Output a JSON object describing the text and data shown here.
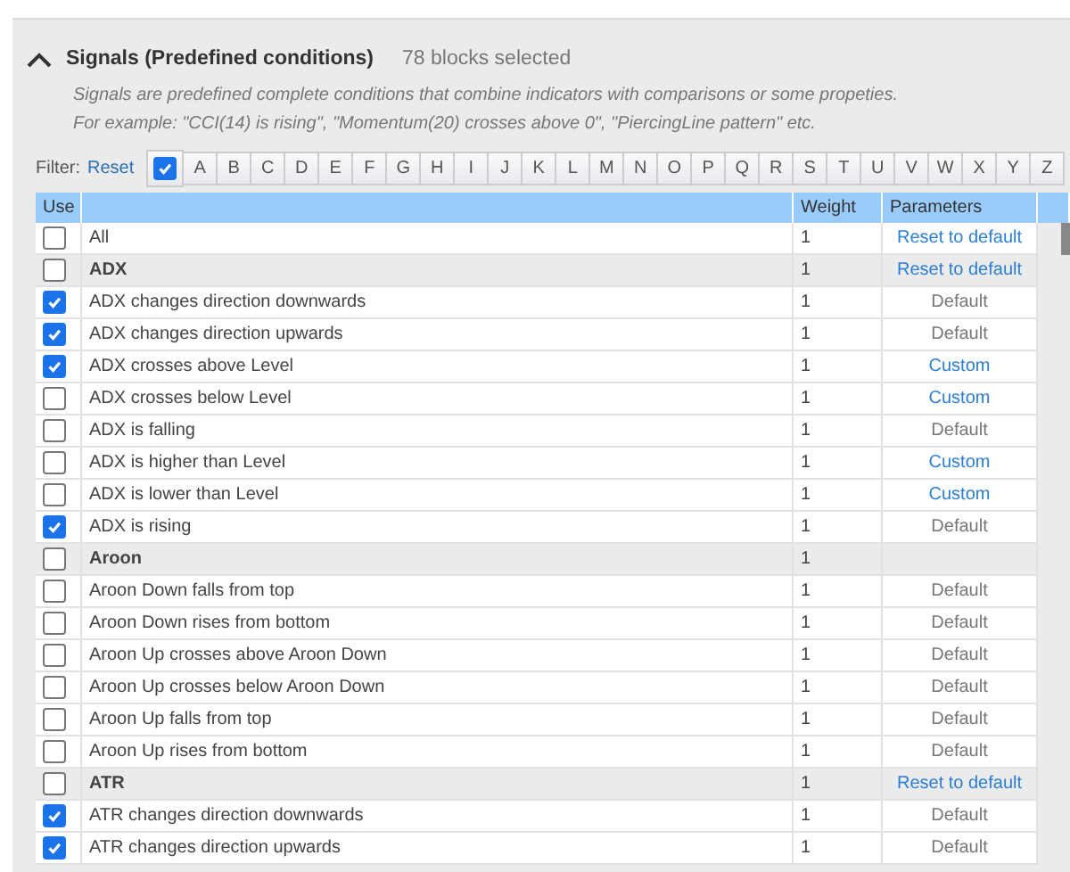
{
  "section": {
    "expanded": true,
    "title": "Signals (Predefined conditions)",
    "count": "78 blocks selected",
    "description": [
      "Signals are predefined complete conditions that combine indicators with comparisons or some propeties.",
      "For example: \"CCI(14) is rising\", \"Momentum(20) crosses above 0\", \"PiercingLine pattern\" etc."
    ]
  },
  "filter": {
    "label": "Filter:",
    "reset": "Reset",
    "all_checked": true,
    "letters": [
      {
        "label": "A",
        "selected": false
      },
      {
        "label": "B",
        "selected": false
      },
      {
        "label": "C",
        "selected": false
      },
      {
        "label": "D",
        "selected": false
      },
      {
        "label": "E",
        "selected": false
      },
      {
        "label": "F",
        "selected": false
      },
      {
        "label": "G",
        "selected": false
      },
      {
        "label": "H",
        "selected": false
      },
      {
        "label": "I",
        "selected": false
      },
      {
        "label": "J",
        "selected": false
      },
      {
        "label": "K",
        "selected": false
      },
      {
        "label": "L",
        "selected": false
      },
      {
        "label": "M",
        "selected": false
      },
      {
        "label": "N",
        "selected": false
      },
      {
        "label": "O",
        "selected": false
      },
      {
        "label": "P",
        "selected": false
      },
      {
        "label": "Q",
        "selected": false
      },
      {
        "label": "R",
        "selected": false
      },
      {
        "label": "S",
        "selected": false
      },
      {
        "label": "T",
        "selected": false
      },
      {
        "label": "U",
        "selected": false
      },
      {
        "label": "V",
        "selected": false
      },
      {
        "label": "W",
        "selected": false
      },
      {
        "label": "X",
        "selected": false
      },
      {
        "label": "Y",
        "selected": false
      },
      {
        "label": "Z",
        "selected": false
      }
    ]
  },
  "table": {
    "columns": [
      "Use",
      "",
      "Weight",
      "Parameters"
    ],
    "rows": [
      {
        "kind": "all",
        "checked": false,
        "name": "All",
        "weight": "1",
        "parameters": {
          "text": "Reset to default",
          "link": true
        }
      },
      {
        "kind": "group",
        "checked": false,
        "name": "ADX",
        "weight": "1",
        "parameters": {
          "text": "Reset to default",
          "link": true
        }
      },
      {
        "kind": "item",
        "checked": true,
        "name": "ADX changes direction downwards",
        "weight": "1",
        "parameters": {
          "text": "Default",
          "link": false
        }
      },
      {
        "kind": "item",
        "checked": true,
        "name": "ADX changes direction upwards",
        "weight": "1",
        "parameters": {
          "text": "Default",
          "link": false
        }
      },
      {
        "kind": "item",
        "checked": true,
        "name": "ADX crosses above Level",
        "weight": "1",
        "parameters": {
          "text": "Custom",
          "link": true
        }
      },
      {
        "kind": "item",
        "checked": false,
        "name": "ADX crosses below Level",
        "weight": "1",
        "parameters": {
          "text": "Custom",
          "link": true
        }
      },
      {
        "kind": "item",
        "checked": false,
        "name": "ADX is falling",
        "weight": "1",
        "parameters": {
          "text": "Default",
          "link": false
        }
      },
      {
        "kind": "item",
        "checked": false,
        "name": "ADX is higher than Level",
        "weight": "1",
        "parameters": {
          "text": "Custom",
          "link": true
        }
      },
      {
        "kind": "item",
        "checked": false,
        "name": "ADX is lower than Level",
        "weight": "1",
        "parameters": {
          "text": "Custom",
          "link": true
        }
      },
      {
        "kind": "item",
        "checked": true,
        "name": "ADX is rising",
        "weight": "1",
        "parameters": {
          "text": "Default",
          "link": false
        }
      },
      {
        "kind": "group",
        "checked": false,
        "name": "Aroon",
        "weight": "1"
      },
      {
        "kind": "item",
        "checked": false,
        "name": "Aroon Down falls from top",
        "weight": "1",
        "parameters": {
          "text": "Default",
          "link": false
        }
      },
      {
        "kind": "item",
        "checked": false,
        "name": "Aroon Down rises from bottom",
        "weight": "1",
        "parameters": {
          "text": "Default",
          "link": false
        }
      },
      {
        "kind": "item",
        "checked": false,
        "name": "Aroon Up crosses above Aroon Down",
        "weight": "1",
        "parameters": {
          "text": "Default",
          "link": false
        }
      },
      {
        "kind": "item",
        "checked": false,
        "name": "Aroon Up crosses below Aroon Down",
        "weight": "1",
        "parameters": {
          "text": "Default",
          "link": false
        }
      },
      {
        "kind": "item",
        "checked": false,
        "name": "Aroon Up falls from top",
        "weight": "1",
        "parameters": {
          "text": "Default",
          "link": false
        }
      },
      {
        "kind": "item",
        "checked": false,
        "name": "Aroon Up rises from bottom",
        "weight": "1",
        "parameters": {
          "text": "Default",
          "link": false
        }
      },
      {
        "kind": "group",
        "checked": false,
        "name": "ATR",
        "weight": "1",
        "parameters": {
          "text": "Reset to default",
          "link": true
        }
      },
      {
        "kind": "item",
        "checked": true,
        "name": "ATR changes direction downwards",
        "weight": "1",
        "parameters": {
          "text": "Default",
          "link": false
        }
      },
      {
        "kind": "item",
        "checked": true,
        "name": "ATR changes direction upwards",
        "weight": "1",
        "parameters": {
          "text": "Default",
          "link": false
        }
      }
    ]
  }
}
